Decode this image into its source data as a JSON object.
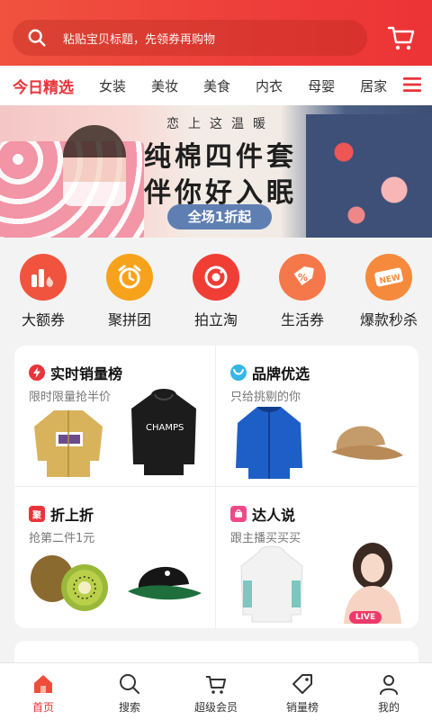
{
  "header": {
    "search_placeholder": "粘贴宝贝标题，先领券再购物"
  },
  "tabs": [
    "今日精选",
    "女装",
    "美妆",
    "美食",
    "内衣",
    "母婴",
    "居家"
  ],
  "banner": {
    "subtitle": "恋上这温暖",
    "line1": "纯棉四件套",
    "line2": "伴你好入眠",
    "pill": "全场1折起"
  },
  "quick_links": [
    {
      "label": "大额券",
      "icon": "coupon-chart-icon",
      "color": "#f0543e"
    },
    {
      "label": "聚拼团",
      "icon": "alarm-clock-icon",
      "color": "#f7a21b"
    },
    {
      "label": "拍立淘",
      "icon": "camera-icon",
      "color": "#f03e35"
    },
    {
      "label": "生活券",
      "icon": "tag-percent-icon",
      "color": "#f5784a"
    },
    {
      "label": "爆款秒杀",
      "icon": "new-badge-icon",
      "color": "#f58a3d"
    }
  ],
  "cards": [
    {
      "title": "实时销量榜",
      "subtitle": "限时限量抢半价",
      "badge_color": "#e8343a"
    },
    {
      "title": "品牌优选",
      "subtitle": "只给挑剔的你",
      "badge_color": "#35b5e5"
    },
    {
      "title": "折上折",
      "subtitle": "抢第二件1元",
      "badge_color": "#e8343a"
    },
    {
      "title": "达人说",
      "subtitle": "跟主播买买买",
      "badge_color": "#ee4a8a"
    }
  ],
  "products": {
    "hoodie_print": "CHAMPS",
    "live_badge": "LIVE"
  },
  "bottom_nav": [
    {
      "label": "首页",
      "active": true
    },
    {
      "label": "搜索",
      "active": false
    },
    {
      "label": "超级会员",
      "active": false
    },
    {
      "label": "销量榜",
      "active": false
    },
    {
      "label": "我的",
      "active": false
    }
  ],
  "colors": {
    "accent": "#e8343a",
    "header": "#ee3e3a"
  }
}
